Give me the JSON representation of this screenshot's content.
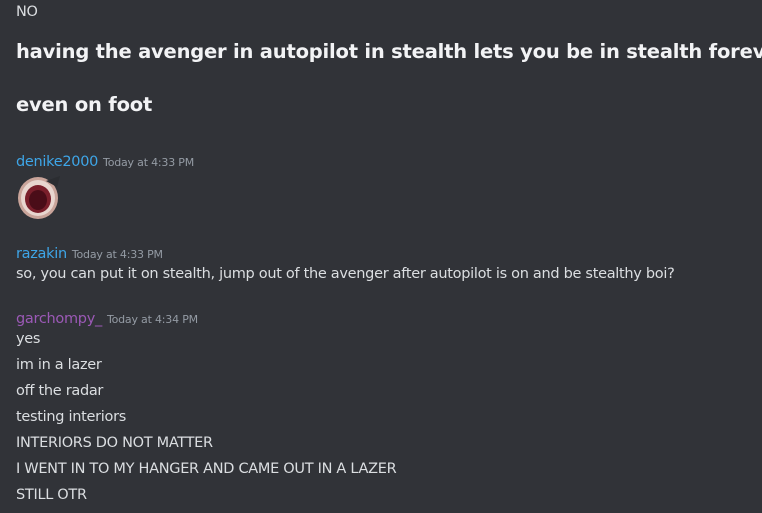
{
  "top_messages": [
    {
      "text": "NO",
      "style": "normal"
    },
    {
      "text": "having the avenger in autopilot in stealth lets you be in stealth forever",
      "style": "big"
    },
    {
      "text": "even on foot",
      "style": "big"
    }
  ],
  "messages": [
    {
      "username": "denike2000",
      "username_color": "#3ea6e8",
      "timestamp": "Today at 4:33 PM",
      "content_type": "sticker",
      "sticker_icon": "round-reddish-sticker-icon"
    },
    {
      "username": "razakin",
      "username_color": "#3ea6e8",
      "timestamp": "Today at 4:33 PM",
      "lines": [
        "so, you can put it on stealth, jump out of the avenger after autopilot is on and be stealthy boi?"
      ]
    },
    {
      "username": "garchompy_",
      "username_color": "#9b59b6",
      "timestamp": "Today at 4:34 PM",
      "lines": [
        "yes",
        "im in a lazer",
        "off the radar",
        "testing interiors",
        "INTERIORS DO NOT MATTER",
        "I WENT IN TO MY HANGER AND CAME OUT IN A LAZER",
        "STILL OTR"
      ]
    }
  ]
}
